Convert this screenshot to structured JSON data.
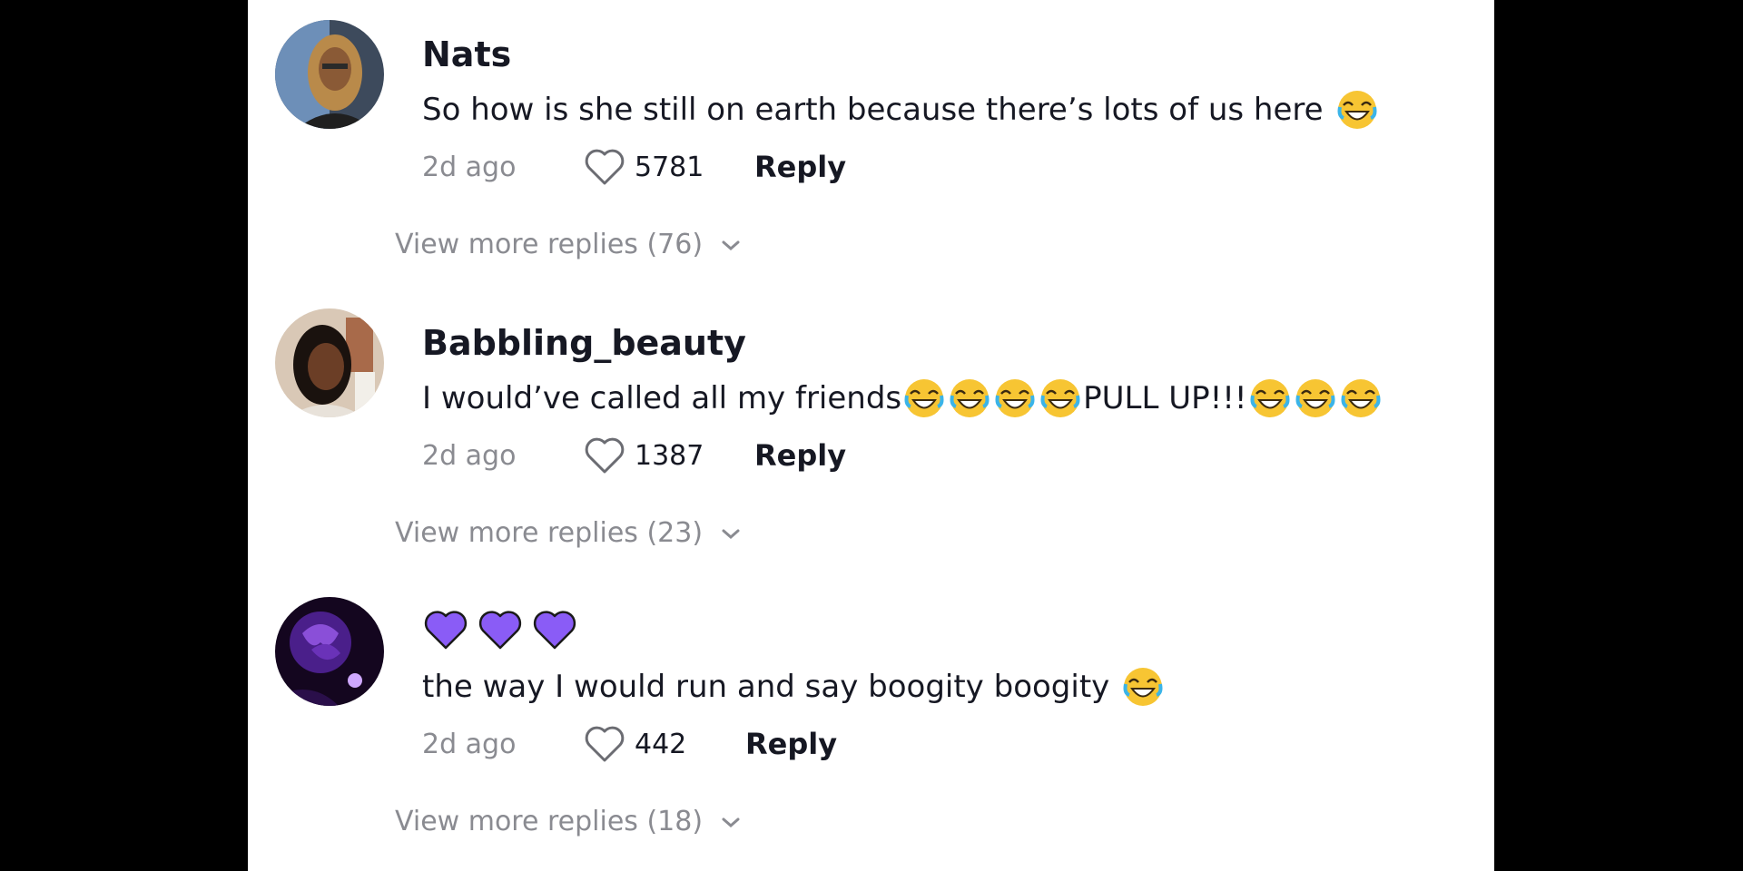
{
  "comments": [
    {
      "username": "Nats",
      "text": "So how is she still on earth because there’s lots of us here",
      "time": "2d ago",
      "likes": "5781",
      "reply_label": "Reply",
      "view_more": "View more replies (76)"
    },
    {
      "username": "Babbling_beauty",
      "text_part1": "I would’ve called all my friends",
      "text_part2": "PULL UP!!!",
      "time": "2d ago",
      "likes": "1387",
      "reply_label": "Reply",
      "view_more": "View more replies (23)"
    },
    {
      "username_icons": [
        "purple-heart-icon",
        "purple-heart-icon",
        "purple-heart-icon"
      ],
      "text": "the way I would run and say boogity boogity",
      "time": "2d ago",
      "likes": "442",
      "reply_label": "Reply",
      "view_more": "View more replies (18)"
    }
  ],
  "colors": {
    "text": "#161823",
    "muted": "#8a8b91",
    "heart_purple": "#8a5cf6",
    "emoji_yellow": "#f7c533",
    "tear_blue": "#3bb4e8"
  }
}
